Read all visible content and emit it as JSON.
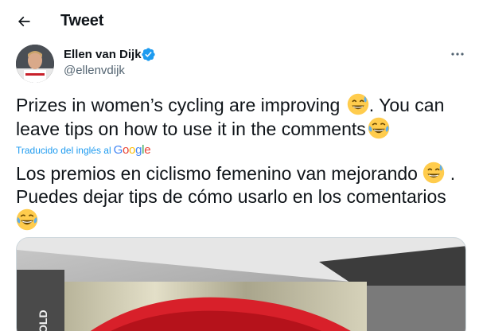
{
  "header": {
    "title": "Tweet",
    "back_icon": "back-arrow-icon"
  },
  "author": {
    "display_name": "Ellen van Dijk",
    "handle": "@ellenvdijk",
    "verified": true
  },
  "tweet": {
    "text_line1": "Prizes in women’s cycling are improving",
    "text_line1_end": ". You can",
    "text_line2": "leave tips on how to use it in the comments",
    "emojis": [
      "grinning-face-with-sweat",
      "face-with-tears-of-joy"
    ]
  },
  "translation": {
    "label": "Traducido del inglés al",
    "provider": [
      "G",
      "o",
      "o",
      "g",
      "l",
      "e"
    ],
    "line1": "Los premios en ciclismo femenino van mejorando",
    "line1_end": " .",
    "line2": "Puedes dejar tips de cómo usarlo en los comentarios"
  },
  "colors": {
    "accent": "#1d9bf0",
    "text": "#0f1419",
    "secondary": "#536471"
  }
}
